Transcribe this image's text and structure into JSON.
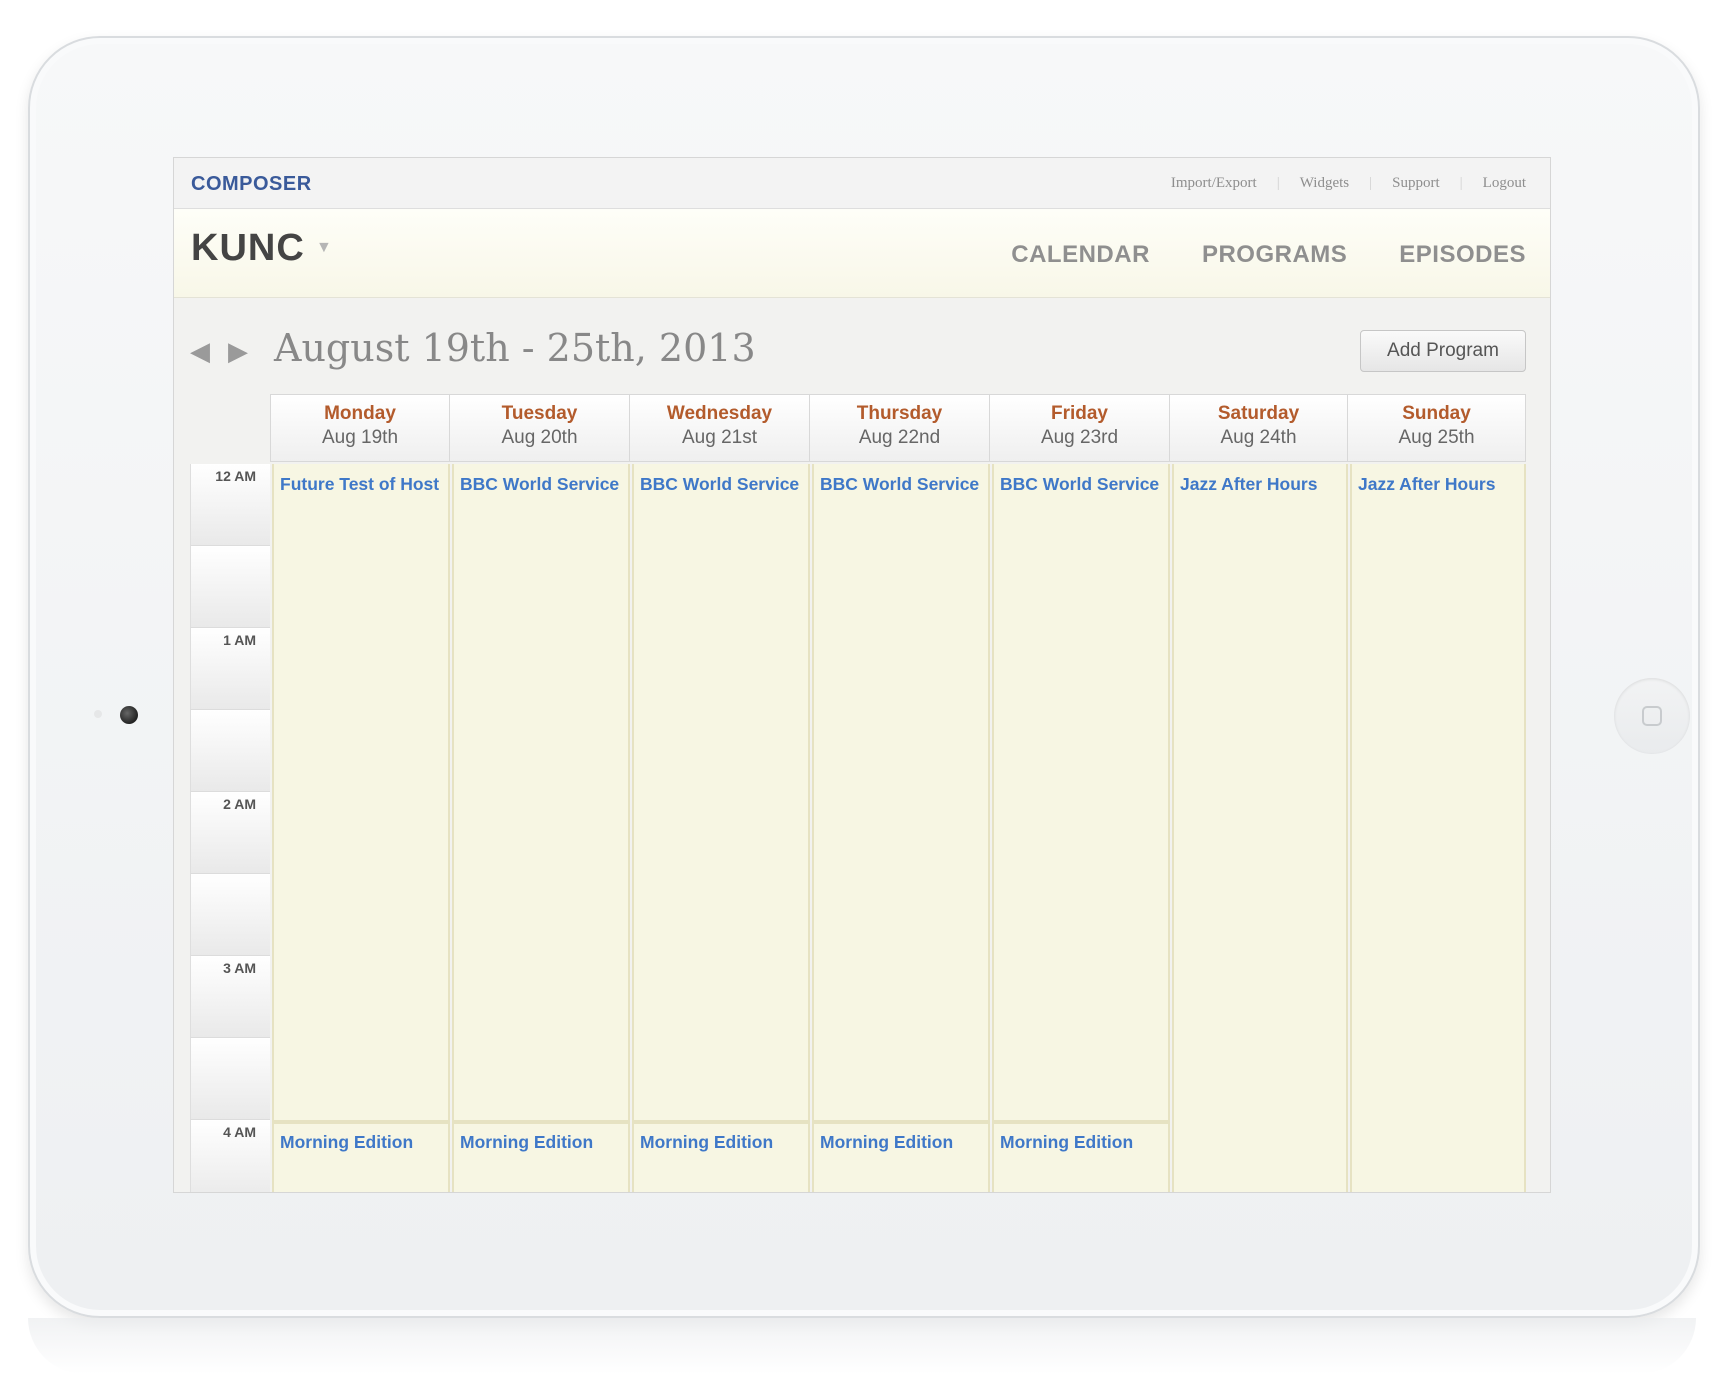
{
  "app": {
    "brand": "COMPOSER"
  },
  "util_links": [
    "Import/Export",
    "Widgets",
    "Support",
    "Logout"
  ],
  "station": {
    "name": "KUNC",
    "caret": "▼"
  },
  "main_nav": [
    "CALENDAR",
    "PROGRAMS",
    "EPISODES"
  ],
  "week": {
    "prev_icon": "◀",
    "next_icon": "▶",
    "title": "August 19th - 25th, 2013",
    "add_button": "Add Program"
  },
  "days": [
    {
      "name": "Monday",
      "date": "Aug 19th"
    },
    {
      "name": "Tuesday",
      "date": "Aug 20th"
    },
    {
      "name": "Wednesday",
      "date": "Aug 21st"
    },
    {
      "name": "Thursday",
      "date": "Aug 22nd"
    },
    {
      "name": "Friday",
      "date": "Aug 23rd"
    },
    {
      "name": "Saturday",
      "date": "Aug 24th"
    },
    {
      "name": "Sunday",
      "date": "Aug 25th"
    }
  ],
  "time_labels": [
    "12 AM",
    "1 AM",
    "2 AM",
    "3 AM",
    "4 AM"
  ],
  "events": {
    "monday": [
      "Future Test of Host",
      "Morning Edition"
    ],
    "tuesday": [
      "BBC World Service",
      "Morning Edition"
    ],
    "wednesday": [
      "BBC World Service",
      "Morning Edition"
    ],
    "thursday": [
      "BBC World Service",
      "Morning Edition"
    ],
    "friday": [
      "BBC World Service",
      "Morning Edition"
    ],
    "saturday": [
      "Jazz After Hours"
    ],
    "sunday": [
      "Jazz After Hours"
    ]
  },
  "colors": {
    "brand": "#3a5a9a",
    "day_name": "#b35b2c",
    "event_link": "#3f78c8",
    "event_bg": "#f7f6e3"
  }
}
